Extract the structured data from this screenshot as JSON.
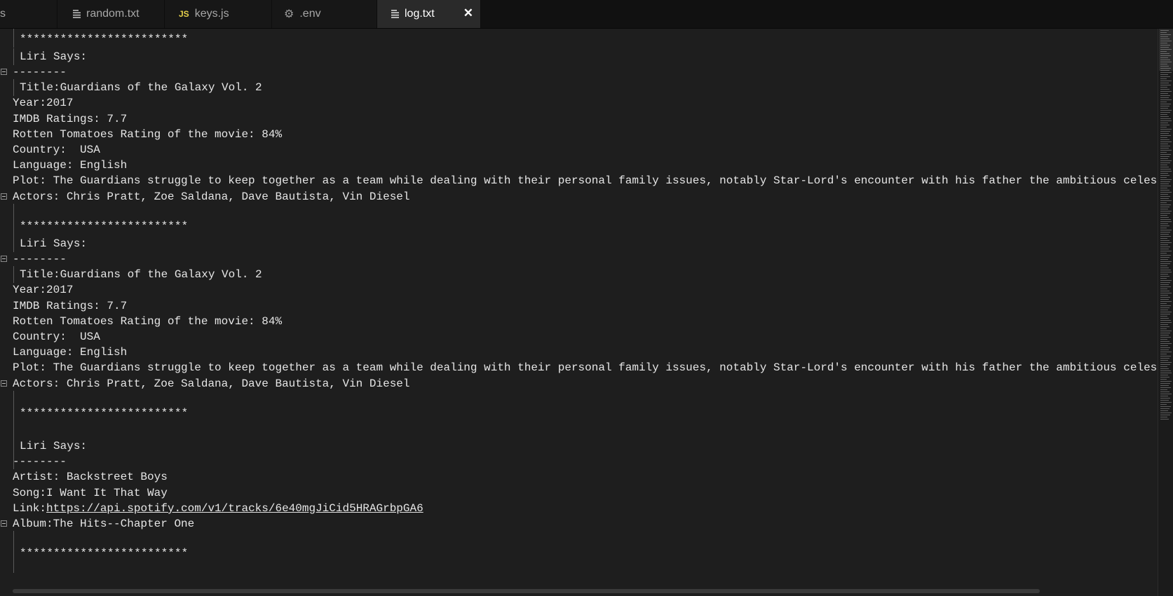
{
  "tabs": [
    {
      "id": "partial",
      "label": "s",
      "icon": "none"
    },
    {
      "id": "random",
      "label": "random.txt",
      "icon": "file-text-icon"
    },
    {
      "id": "keys",
      "label": "keys.js",
      "icon": "js-file-icon",
      "icon_text": "JS"
    },
    {
      "id": "env",
      "label": ".env",
      "icon": "gear-icon",
      "icon_glyph": "⚙"
    },
    {
      "id": "log",
      "label": "log.txt",
      "icon": "file-text-icon",
      "active": true,
      "close_glyph": "✕"
    }
  ],
  "editor": {
    "lines": [
      "*************************",
      "Liri Says:",
      "--------",
      "Title:Guardians of the Galaxy Vol. 2",
      "Year:2017",
      "IMDB Ratings: 7.7",
      "Rotten Tomatoes Rating of the movie: 84%",
      "Country:  USA",
      "Language: English",
      "Plot: The Guardians struggle to keep together as a team while dealing with their personal family issues, notably Star-Lord's encounter with his father the ambitious celes",
      "Actors: Chris Pratt, Zoe Saldana, Dave Bautista, Vin Diesel",
      "",
      "*************************",
      "Liri Says:",
      "--------",
      "Title:Guardians of the Galaxy Vol. 2",
      "Year:2017",
      "IMDB Ratings: 7.7",
      "Rotten Tomatoes Rating of the movie: 84%",
      "Country:  USA",
      "Language: English",
      "Plot: The Guardians struggle to keep together as a team while dealing with their personal family issues, notably Star-Lord's encounter with his father the ambitious celes",
      "Actors: Chris Pratt, Zoe Saldana, Dave Bautista, Vin Diesel",
      "",
      "*************************",
      "",
      "Liri Says:",
      "--------",
      "Artist: Backstreet Boys",
      "Song:I Want It That Way",
      "Album:The Hits--Chapter One",
      "",
      "*************************"
    ],
    "link_line": {
      "prefix": "Link:",
      "url": "https://api.spotify.com/v1/tracks/6e40mgJiCid5HRAGrbpGA6"
    }
  }
}
